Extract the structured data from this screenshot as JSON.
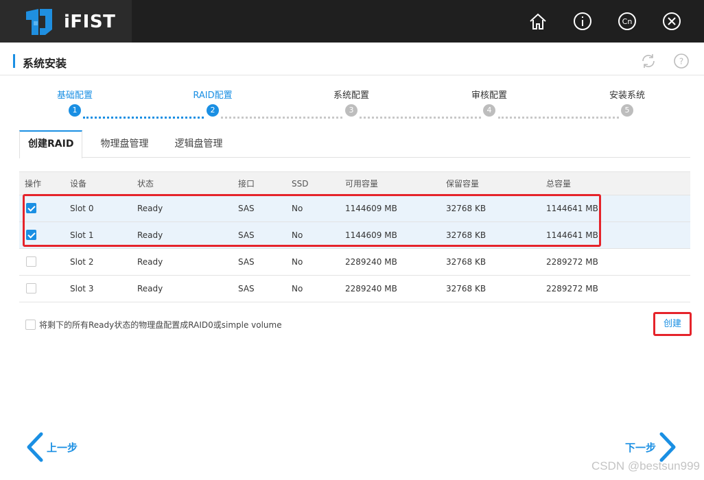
{
  "app": {
    "name": "iFIST"
  },
  "header_icons": [
    "home-icon",
    "info-icon",
    "language-icon",
    "close-icon"
  ],
  "page": {
    "title": "系统安装"
  },
  "steps": [
    {
      "num": "1",
      "label": "基础配置",
      "active": true
    },
    {
      "num": "2",
      "label": "RAID配置",
      "active": true
    },
    {
      "num": "3",
      "label": "系统配置",
      "active": false
    },
    {
      "num": "4",
      "label": "审核配置",
      "active": false
    },
    {
      "num": "5",
      "label": "安装系统",
      "active": false
    }
  ],
  "tabs": [
    {
      "label": "创建RAID",
      "active": true
    },
    {
      "label": "物理盘管理",
      "active": false
    },
    {
      "label": "逻辑盘管理",
      "active": false
    }
  ],
  "table": {
    "headers": [
      "操作",
      "设备",
      "状态",
      "接口",
      "SSD",
      "可用容量",
      "保留容量",
      "总容量"
    ],
    "rows": [
      {
        "checked": true,
        "device": "Slot 0",
        "status": "Ready",
        "interface": "SAS",
        "ssd": "No",
        "available": "1144609 MB",
        "reserved": "32768 KB",
        "total": "1144641 MB"
      },
      {
        "checked": true,
        "device": "Slot 1",
        "status": "Ready",
        "interface": "SAS",
        "ssd": "No",
        "available": "1144609 MB",
        "reserved": "32768 KB",
        "total": "1144641 MB"
      },
      {
        "checked": false,
        "device": "Slot 2",
        "status": "Ready",
        "interface": "SAS",
        "ssd": "No",
        "available": "2289240 MB",
        "reserved": "32768 KB",
        "total": "2289272 MB"
      },
      {
        "checked": false,
        "device": "Slot 3",
        "status": "Ready",
        "interface": "SAS",
        "ssd": "No",
        "available": "2289240 MB",
        "reserved": "32768 KB",
        "total": "2289272 MB"
      }
    ]
  },
  "remaining_option": {
    "label": "将剩下的所有Ready状态的物理盘配置成RAID0或simple volume",
    "checked": false
  },
  "create_button": {
    "label": "创建"
  },
  "nav": {
    "prev": "上一步",
    "next": "下一步"
  },
  "watermark": "CSDN @bestsun999",
  "colors": {
    "accent": "#1a8fe3",
    "highlight": "#e5232a",
    "topbar": "#1f1f1f"
  }
}
